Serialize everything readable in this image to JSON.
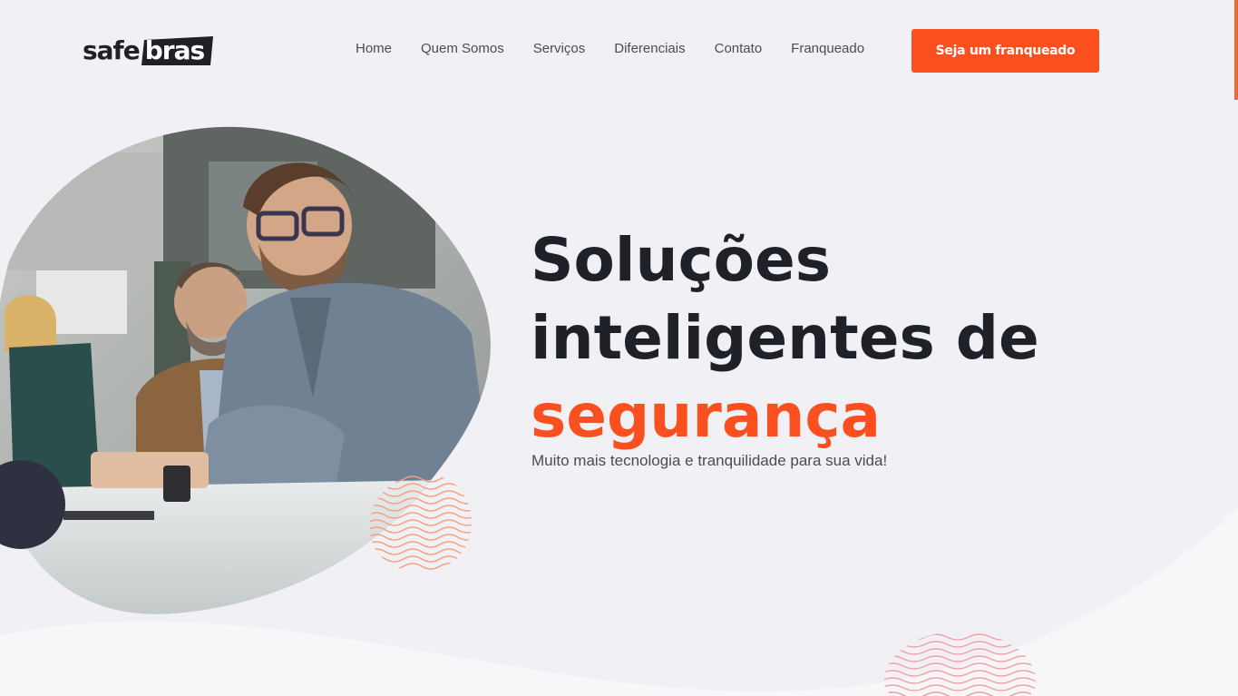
{
  "brand": {
    "logo_part1": "safe",
    "logo_part2": "bras"
  },
  "nav": {
    "items": [
      {
        "label": "Home"
      },
      {
        "label": "Quem Somos"
      },
      {
        "label": "Serviços"
      },
      {
        "label": "Diferenciais"
      },
      {
        "label": "Contato"
      },
      {
        "label": "Franqueado"
      }
    ],
    "cta_label": "Seja um franqueado"
  },
  "hero": {
    "title_line1": "Soluções",
    "title_line2": "inteligentes de",
    "title_line3": "segurança",
    "subtitle": "Muito mais tecnologia e tranquilidade para sua vida!",
    "image_icon": "team-photo-icon"
  },
  "colors": {
    "accent": "#fa4f1e",
    "text_dark": "#1f2128",
    "background": "#f1f0f5",
    "dark_circle": "#2e3140"
  }
}
